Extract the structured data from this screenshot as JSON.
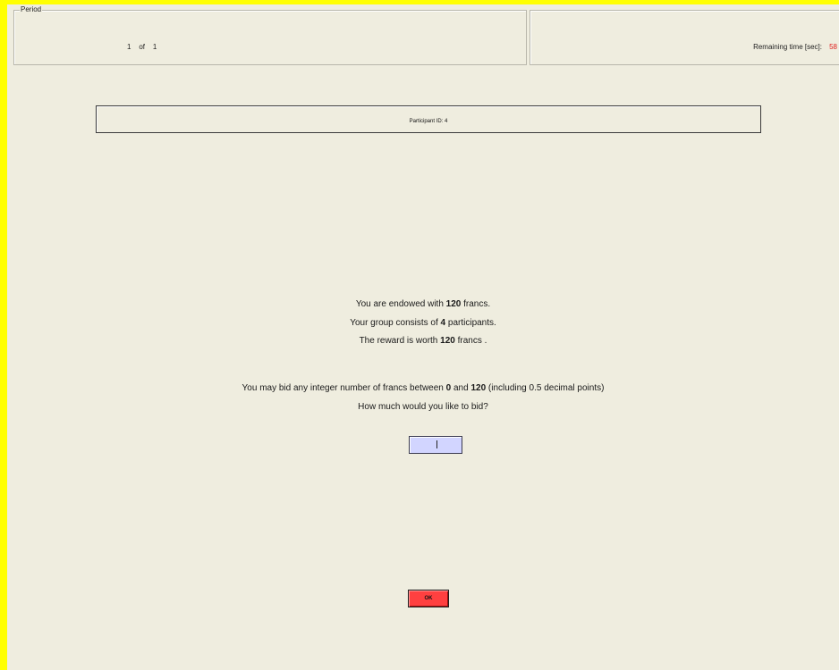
{
  "period": {
    "legend": "Period",
    "current": "1",
    "of_label": "of",
    "total": "1"
  },
  "timer": {
    "label": "Remaining time [sec]:",
    "value": "58",
    "value_color": "#e02020"
  },
  "participant": {
    "label": "Participant ID: 4"
  },
  "instructions": {
    "line1": {
      "prefix": "You are endowed with ",
      "bold": "120",
      "suffix": " francs."
    },
    "line2": {
      "prefix": "Your group consists of ",
      "bold": "4",
      "suffix": " participants."
    },
    "line3": {
      "prefix": "The reward is worth ",
      "bold": "120",
      "suffix": " francs ."
    },
    "line4": {
      "prefix": "You may bid any integer number of francs between ",
      "bold1": "0",
      "middle": " and ",
      "bold2": "120",
      "suffix": " (including 0.5 decimal points)"
    },
    "line5": "How much would you like to bid?"
  },
  "bid_input": {
    "value": "",
    "background": "#d2d5ff"
  },
  "ok_button": {
    "label": "OK",
    "color": "#ff4040"
  },
  "colors": {
    "frame": "#ffff00",
    "background": "#efeddf"
  }
}
